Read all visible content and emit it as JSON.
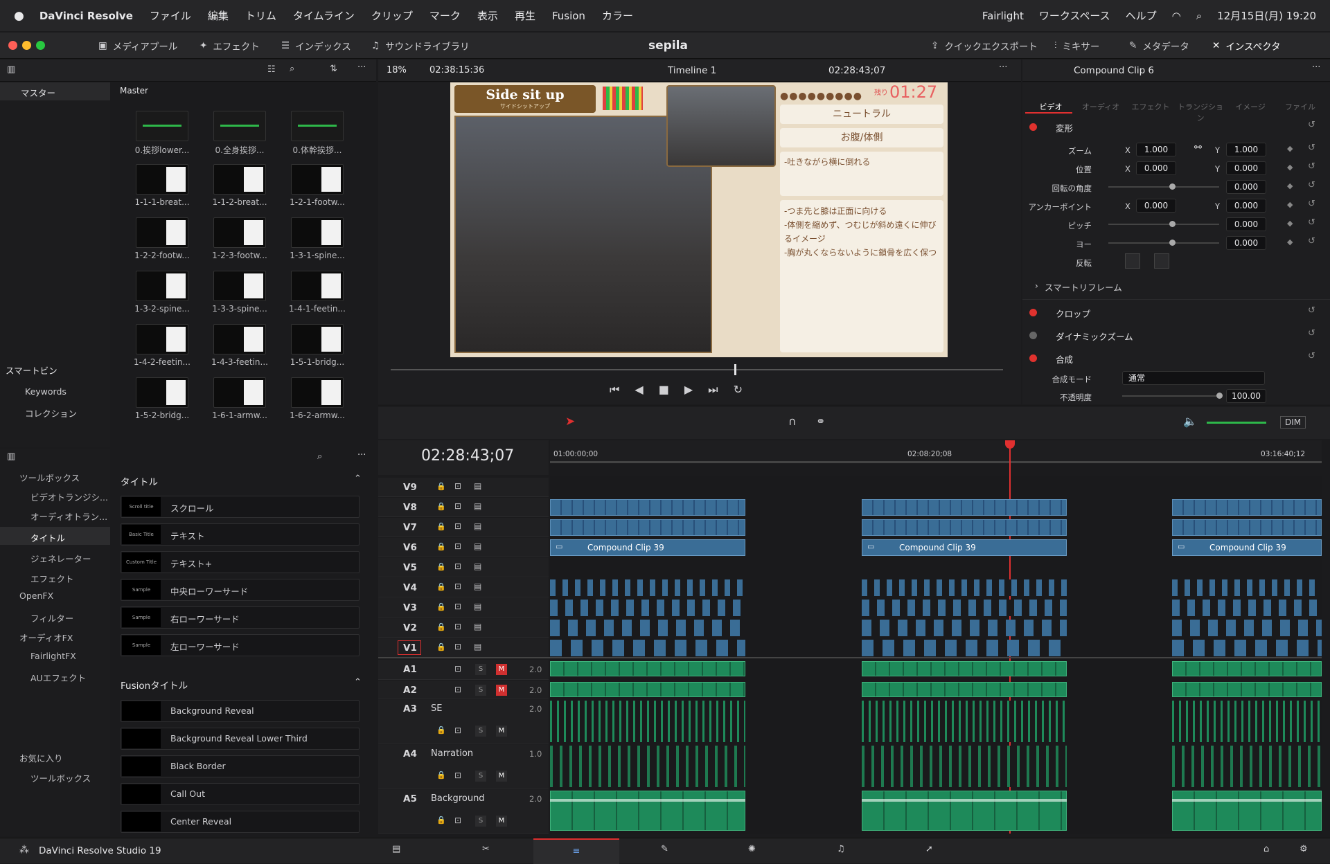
{
  "menubar": {
    "app": "DaVinci Resolve",
    "items": [
      "ファイル",
      "編集",
      "トリム",
      "タイムライン",
      "クリップ",
      "マーク",
      "表示",
      "再生",
      "Fusion",
      "カラー"
    ],
    "right_items": [
      "Fairlight",
      "ワークスペース",
      "ヘルプ"
    ],
    "datetime": "12月15日(月) 19:20"
  },
  "titlebar": {
    "project": "sepila",
    "media_pool": "メディアプール",
    "effects": "エフェクト",
    "index": "インデックス",
    "sound_library": "サウンドライブラリ",
    "quick_export": "クイックエクスポート",
    "mixer": "ミキサー",
    "metadata": "メタデータ",
    "inspector": "インスペクタ"
  },
  "viewer": {
    "zoom": "18%",
    "source_tc": "02:38:15:36",
    "timeline_name": "Timeline 1",
    "record_tc": "02:28:43;07"
  },
  "preview": {
    "title": "Side sit up",
    "subtitle": "サイドシットアップ",
    "remaining_label": "残り",
    "remaining": "01:27",
    "box1": "ニュートラル",
    "box2": "お腹/体側",
    "box3": "-吐きながら横に倒れる",
    "notes": [
      "-つま先と膝は正面に向ける",
      "-体側を縮めず、つむじが斜め遠くに伸びるイメージ",
      "-胸が丸くならないように鎖骨を広く保つ"
    ]
  },
  "bins": {
    "master_tab": "マスター",
    "master_header": "Master",
    "smart_bins": "スマートビン",
    "keywords": "Keywords",
    "collection": "コレクション"
  },
  "media": [
    "0.挨拶lower...",
    "0.全身挨拶...",
    "0.体幹挨拶...",
    "1-1-1-breat...",
    "1-1-2-breat...",
    "1-2-1-footw...",
    "1-2-2-footw...",
    "1-2-3-footw...",
    "1-3-1-spine...",
    "1-3-2-spine...",
    "1-3-3-spine...",
    "1-4-1-feetin...",
    "1-4-2-feetin...",
    "1-4-3-feetin...",
    "1-5-1-bridg...",
    "1-5-2-bridg...",
    "1-6-1-armw...",
    "1-6-2-armw..."
  ],
  "toolbox": {
    "items": [
      "ツールボックス",
      "ビデオトランジシ...",
      "オーディオトラン...",
      "タイトル",
      "ジェネレーター",
      "エフェクト",
      "OpenFX",
      "フィルター",
      "オーディオFX",
      "FairlightFX",
      "AUエフェクト",
      "お気に入り",
      "ツールボックス"
    ]
  },
  "titles": {
    "header": "タイトル",
    "items": [
      "スクロール",
      "テキスト",
      "テキスト+",
      "中央ローワーサード",
      "右ローワーサード",
      "左ローワーサード"
    ],
    "thumbs": [
      "Scroll title",
      "Basic Title",
      "Custom Title",
      "Sample",
      "Sample",
      "Sample"
    ],
    "fusion_header": "Fusionタイトル",
    "fusion_items": [
      "Background Reveal",
      "Background Reveal Lower Third",
      "Black Border",
      "Call Out",
      "Center Reveal"
    ]
  },
  "timeline": {
    "timecode": "02:28:43;07",
    "ruler": [
      "01:00:00;00",
      "02:08:20;08",
      "03:16:40;12"
    ],
    "video_tracks": [
      "V9",
      "V8",
      "V7",
      "V6",
      "V5",
      "V4",
      "V3",
      "V2",
      "V1"
    ],
    "compound_clip": "Compound Clip 39",
    "audio_tracks": [
      {
        "id": "A1",
        "name": "",
        "level": "2.0"
      },
      {
        "id": "A2",
        "name": "",
        "level": "2.0"
      },
      {
        "id": "A3",
        "name": "SE",
        "level": "2.0"
      },
      {
        "id": "A4",
        "name": "Narration",
        "level": "1.0"
      },
      {
        "id": "A5",
        "name": "Background",
        "level": "2.0"
      }
    ],
    "dim": "DIM"
  },
  "inspector": {
    "clip": "Compound Clip 6",
    "tabs": [
      "ビデオ",
      "オーディオ",
      "エフェクト",
      "トランジション",
      "イメージ",
      "ファイル"
    ],
    "transform": "変形",
    "zoom_label": "ズーム",
    "zoom_x": "1.000",
    "zoom_y": "1.000",
    "pos_label": "位置",
    "pos_x": "0.000",
    "pos_y": "0.000",
    "rot_label": "回転の角度",
    "rot": "0.000",
    "anchor_label": "アンカーポイント",
    "anchor_x": "0.000",
    "anchor_y": "0.000",
    "pitch_label": "ピッチ",
    "pitch": "0.000",
    "yaw_label": "ヨー",
    "yaw": "0.000",
    "flip_label": "反転",
    "smart_reframe": "スマートリフレーム",
    "crop": "クロップ",
    "dynamic_zoom": "ダイナミックズーム",
    "composite": "合成",
    "blend_label": "合成モード",
    "blend": "通常",
    "opacity_label": "不透明度",
    "opacity": "100.00",
    "x": "X",
    "y": "Y"
  },
  "footer": {
    "brand": "DaVinci Resolve Studio 19"
  }
}
